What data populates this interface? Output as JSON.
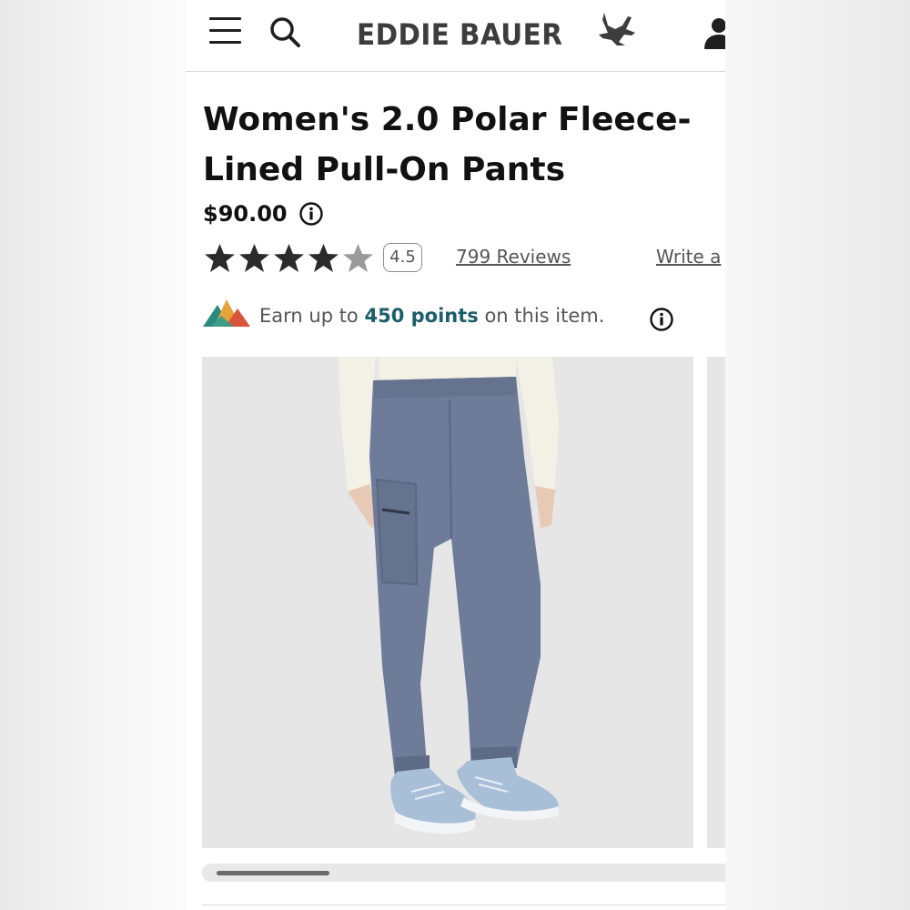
{
  "header": {
    "brand": "EDDIE BAUER",
    "menu_icon": "hamburger-menu-icon",
    "search_icon": "search-icon",
    "account_icon": "account-icon",
    "brand_mark": "goose-logo-icon"
  },
  "product": {
    "title": "Women's 2.0 Polar Fleece-\nLined Pull-On Pants",
    "price": "$90.00",
    "rating_value": "4.5",
    "rating_stars": 4.5,
    "rating_max": 5,
    "reviews_link": "799 Reviews",
    "write_review_link": "Write a"
  },
  "rewards": {
    "prefix": "Earn up to ",
    "points": "450 points",
    "suffix": " on this item."
  },
  "gallery": {
    "image_subject": "model wearing slate blue pull-on jogger pants with light blue sneakers",
    "pants_color": "#6e7c9a",
    "shoe_color": "#a9bfd8",
    "background_color": "#e6e6e6"
  },
  "colors": {
    "text": "#111111",
    "muted": "#555555",
    "accent": "#1b5e6b",
    "star": "#2b2b2b"
  }
}
